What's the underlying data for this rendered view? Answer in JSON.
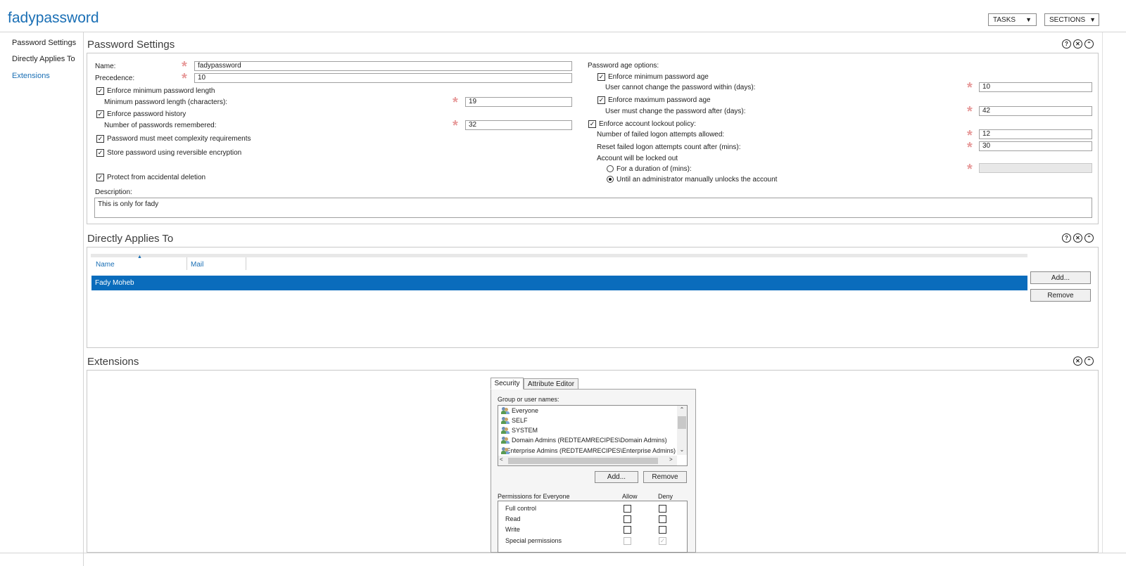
{
  "app": {
    "title": "fadypassword"
  },
  "header": {
    "tasks_label": "TASKS",
    "sections_label": "SECTIONS"
  },
  "sidebar": {
    "items": [
      {
        "label": "Password Settings",
        "active": false
      },
      {
        "label": "Directly Applies To",
        "active": false
      },
      {
        "label": "Extensions",
        "active": true
      }
    ]
  },
  "password_settings": {
    "title": "Password Settings",
    "name_label": "Name:",
    "name_value": "fadypassword",
    "precedence_label": "Precedence:",
    "precedence_value": "10",
    "enforce_min_length_label": "Enforce minimum password length",
    "enforce_min_length_checked": true,
    "min_length_label": "Minimum password length (characters):",
    "min_length_value": "19",
    "enforce_history_label": "Enforce password history",
    "enforce_history_checked": true,
    "history_label": "Number of passwords remembered:",
    "history_value": "32",
    "complexity_label": "Password must meet complexity requirements",
    "complexity_checked": true,
    "reversible_label": "Store password using reversible encryption",
    "reversible_checked": true,
    "protect_label": "Protect from accidental deletion",
    "protect_checked": true,
    "description_label": "Description:",
    "description_value": "This is only for fady",
    "age_options_label": "Password age options:",
    "enforce_min_age_label": "Enforce minimum password age",
    "enforce_min_age_checked": true,
    "min_age_label": "User cannot change the password within (days):",
    "min_age_value": "10",
    "enforce_max_age_label": "Enforce maximum password age",
    "enforce_max_age_checked": true,
    "max_age_label": "User must change the password after (days):",
    "max_age_value": "42",
    "lockout_label": "Enforce account lockout policy:",
    "lockout_checked": true,
    "failed_attempts_label": "Number of failed logon attempts allowed:",
    "failed_attempts_value": "12",
    "reset_count_label": "Reset failed logon attempts count after (mins):",
    "reset_count_value": "30",
    "locked_out_label": "Account will be locked out",
    "duration_label": "For a duration of (mins):",
    "duration_value": "",
    "admin_unlock_label": "Until an administrator manually unlocks the account",
    "selected_lockout_option": "admin_unlock"
  },
  "applies_to": {
    "title": "Directly Applies To",
    "columns": [
      "Name",
      "Mail"
    ],
    "rows": [
      {
        "name": "Fady Moheb",
        "mail": "",
        "selected": true
      }
    ],
    "add_label": "Add...",
    "remove_label": "Remove"
  },
  "extensions": {
    "title": "Extensions",
    "tabs": [
      "Security",
      "Attribute Editor"
    ],
    "active_tab": "Security",
    "group_label": "Group or user names:",
    "principals": [
      "Everyone",
      "SELF",
      "SYSTEM",
      "Domain Admins (REDTEAMRECIPES\\Domain Admins)",
      "Enterprise Admins (REDTEAMRECIPES\\Enterprise Admins)"
    ],
    "add_label": "Add...",
    "remove_label": "Remove",
    "permissions_label": "Permissions for Everyone",
    "allow_label": "Allow",
    "deny_label": "Deny",
    "permissions": [
      {
        "name": "Full control",
        "allow": false,
        "deny": false
      },
      {
        "name": "Read",
        "allow": false,
        "deny": false
      },
      {
        "name": "Write",
        "allow": false,
        "deny": false
      },
      {
        "name": "Special permissions",
        "allow": false,
        "deny": true,
        "disabled": true
      }
    ]
  },
  "icons": {
    "help": "question-icon",
    "close": "close-icon",
    "collapse": "chevron-up-icon",
    "dropdown": "dropdown-arrow-icon",
    "scroll_up": "chevron-up-icon",
    "scroll_down": "chevron-down-icon",
    "user": "user-group-icon"
  },
  "colors": {
    "accent": "#1a6fb5",
    "selection": "#0a6cbc",
    "required_star": "#e79a9a"
  }
}
